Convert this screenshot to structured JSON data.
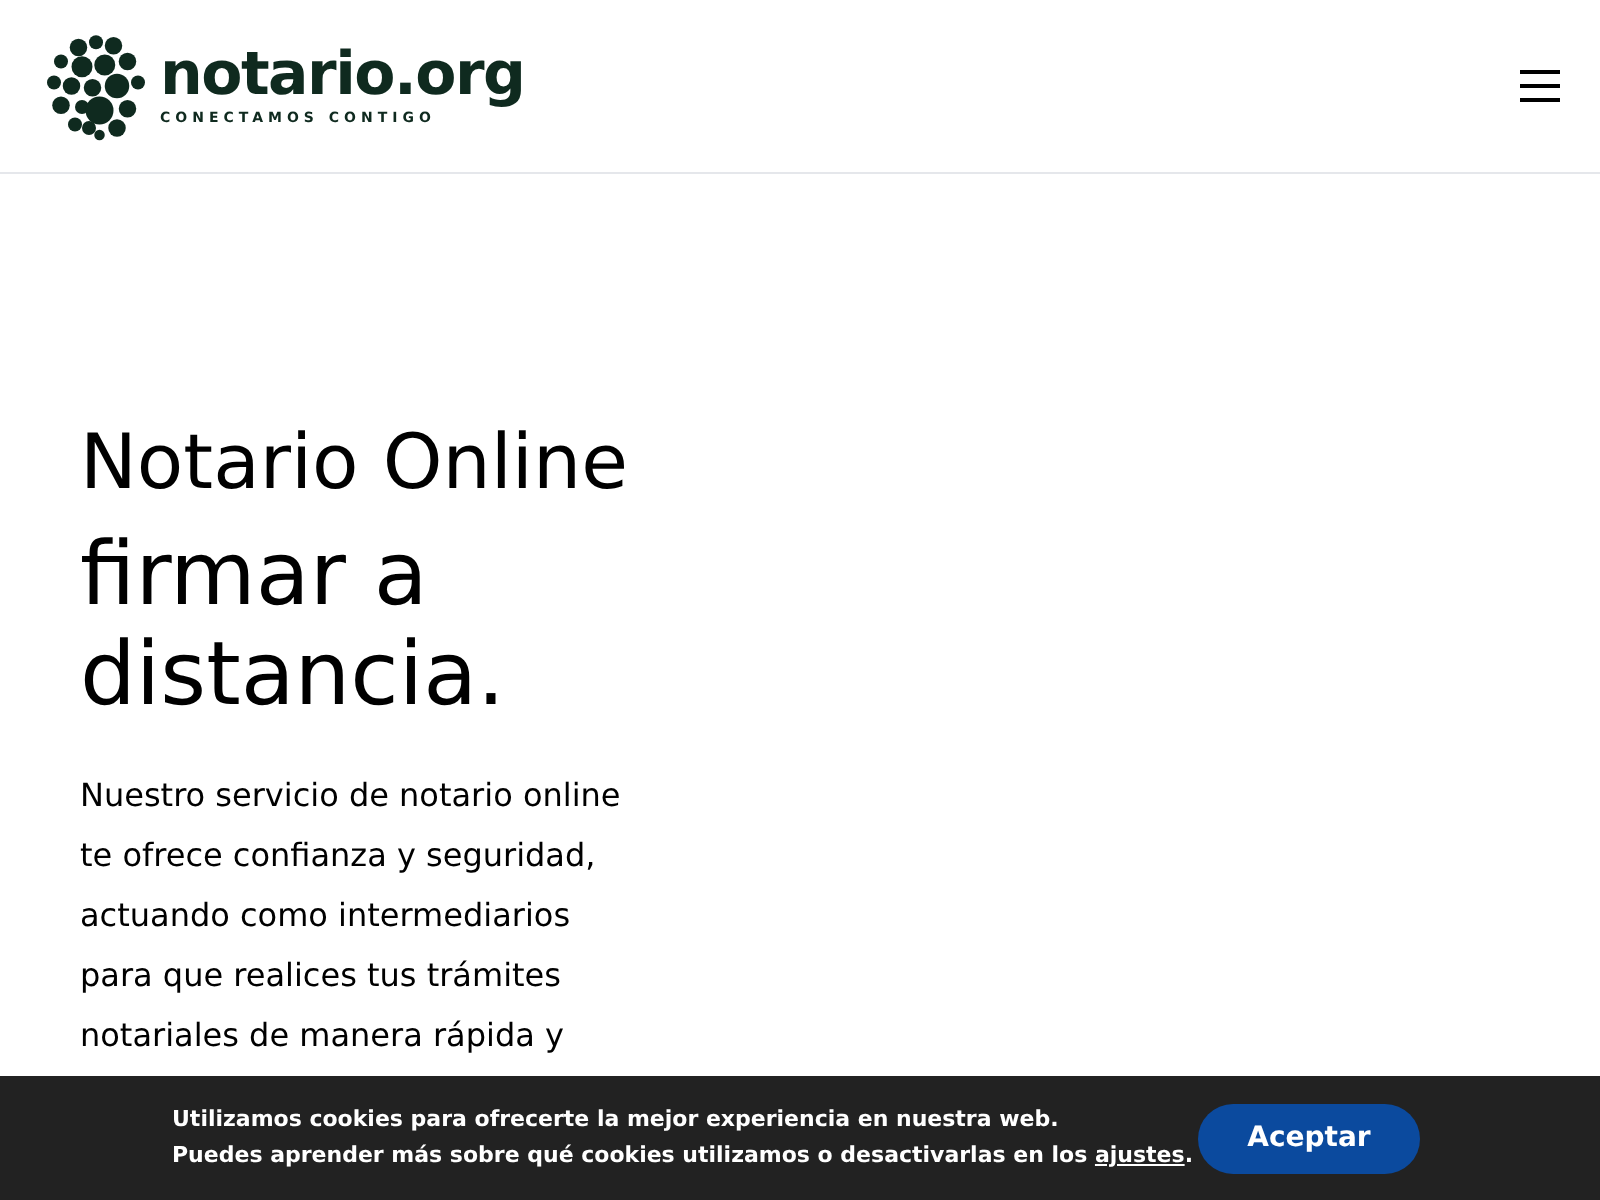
{
  "header": {
    "logo_name": "notario.org",
    "logo_tagline": "CONECTAMOS CONTIGO"
  },
  "hero": {
    "title": "Notario Online",
    "headline": [
      "firmar a",
      "distancia."
    ],
    "paragraph_lines": [
      "Nuestro servicio de notario online",
      "te ofrece confianza y seguridad,",
      "actuando como intermediarios",
      "para que realices tus trámites",
      "notariales de manera rápida y"
    ]
  },
  "cookie_banner": {
    "line_1": "Utilizamos cookies para ofrecerte la mejor experiencia en nuestra web.",
    "line_2": "Puedes aprender más sobre qué cookies utilizamos o desactivarlas en los",
    "link": "ajustes",
    "line_2_end": ".",
    "button": "Aceptar"
  }
}
